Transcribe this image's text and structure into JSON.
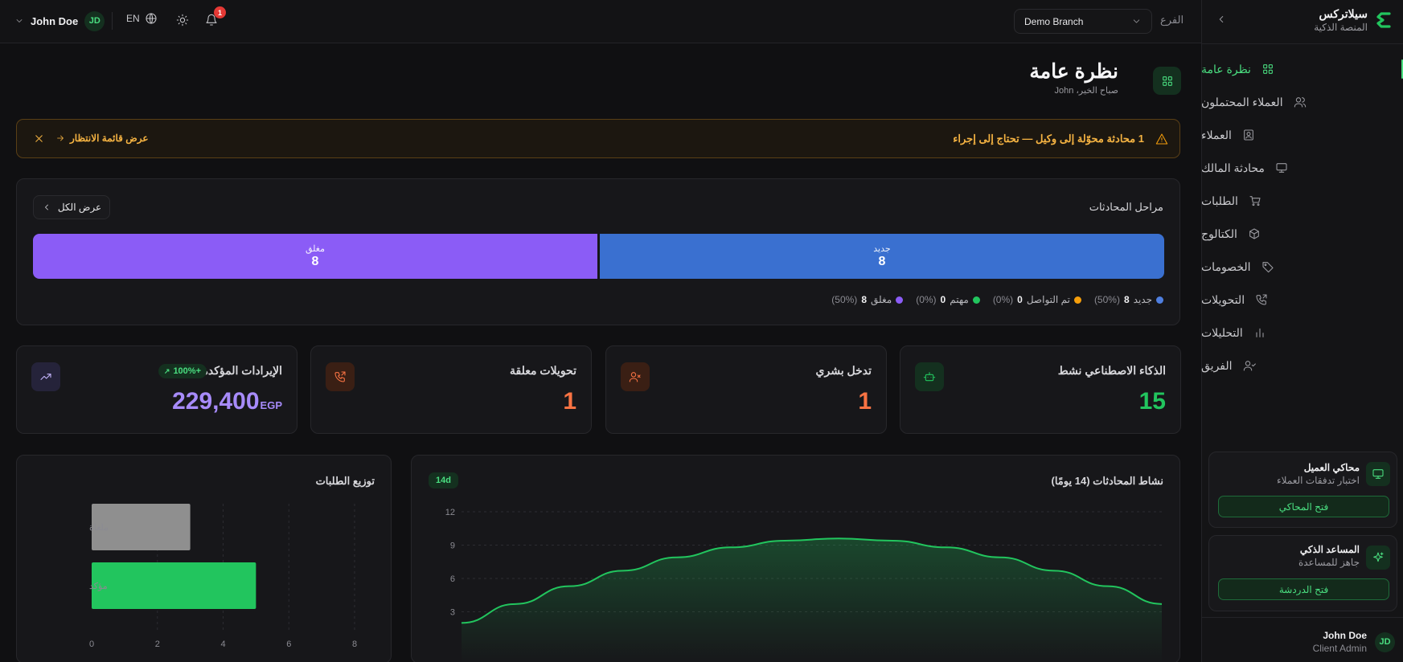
{
  "brand": {
    "name": "سيلاتركس",
    "tagline": "المنصة الذكية"
  },
  "header": {
    "branch_label": "الفرع",
    "branch_value": "Demo Branch",
    "notification_count": "1",
    "language": "EN",
    "user_name": "John Doe",
    "user_initials": "JD"
  },
  "sidebar": {
    "items": [
      {
        "label": "نظرة عامة",
        "icon": "dashboard-icon",
        "active": true
      },
      {
        "label": "العملاء المحتملون",
        "icon": "users-icon"
      },
      {
        "label": "العملاء",
        "icon": "contact-card-icon"
      },
      {
        "label": "محادثة المالك",
        "icon": "monitor-icon"
      },
      {
        "label": "الطلبات",
        "icon": "cart-icon"
      },
      {
        "label": "الكتالوج",
        "icon": "package-icon"
      },
      {
        "label": "الخصومات",
        "icon": "tag-icon"
      },
      {
        "label": "التحويلات",
        "icon": "phone-forward-icon"
      },
      {
        "label": "التحليلات",
        "icon": "bar-chart-icon"
      },
      {
        "label": "الفريق",
        "icon": "team-icon"
      }
    ],
    "simulator": {
      "title": "محاكي العميل",
      "subtitle": "اختبار تدفقات العملاء",
      "button": "فتح المحاكي"
    },
    "assistant": {
      "title": "المساعد الذكي",
      "subtitle": "جاهز للمساعدة",
      "button": "فتح الدردشة"
    },
    "footer_user": {
      "name": "John Doe",
      "role": "Client Admin",
      "initials": "JD"
    }
  },
  "page": {
    "title": "نظرة عامة",
    "greeting": "صباح الخير، John"
  },
  "alert": {
    "message": "1 محادثة محوّلة إلى وكيل — تحتاج إلى إجراء",
    "link": "عرض قائمة الانتظار"
  },
  "stages": {
    "title": "مراحل المحادثات",
    "view_all": "عرض الكل",
    "segments": [
      {
        "label": "جديد",
        "value": "8",
        "color": "#3a70d0",
        "fraction": 0.5
      },
      {
        "label": "مغلق",
        "value": "8",
        "color": "#8b5cf6",
        "fraction": 0.5
      }
    ],
    "legend": [
      {
        "label": "جديد",
        "count": "8",
        "pct": "(50%)",
        "color": "#4f7fe0"
      },
      {
        "label": "تم التواصل",
        "count": "0",
        "pct": "(0%)",
        "color": "#f59e0b"
      },
      {
        "label": "مهتم",
        "count": "0",
        "pct": "(0%)",
        "color": "#22c55e"
      },
      {
        "label": "مغلق",
        "count": "8",
        "pct": "(50%)",
        "color": "#8b5cf6"
      }
    ]
  },
  "stats": [
    {
      "title": "الذكاء الاصطناعي نشط",
      "value": "15",
      "color": "#22c55e",
      "icon": "bot-icon"
    },
    {
      "title": "تدخل بشري",
      "value": "1",
      "color": "#f97343",
      "icon": "user-x-icon"
    },
    {
      "title": "تحويلات معلقة",
      "value": "1",
      "color": "#f97343",
      "icon": "phone-forward-icon"
    },
    {
      "title": "الإيرادات المؤكدة",
      "value": "229,400",
      "unit": "EGP",
      "badge": "100%+",
      "color": "#a78bfa",
      "icon": "trending-up-icon"
    }
  ],
  "activity_chart": {
    "title": "نشاط المحادثات (14 يومًا)",
    "badge": "14d"
  },
  "orders_chart": {
    "title": "توزيع الطلبات"
  },
  "chart_data": [
    {
      "type": "area",
      "title": "نشاط المحادثات (14 يومًا)",
      "x": [
        1,
        2,
        3,
        4,
        5,
        6,
        7,
        8,
        9,
        10,
        11,
        12,
        13,
        14
      ],
      "series": [
        {
          "values": [
            2.0,
            3.7,
            5.3,
            6.7,
            7.9,
            8.8,
            9.4,
            9.6,
            9.4,
            8.8,
            7.9,
            6.7,
            5.3,
            3.7
          ]
        }
      ],
      "yticks": [
        "3",
        "6",
        "9",
        "12"
      ],
      "ylim": [
        0,
        12
      ],
      "grid": true,
      "color": "#22c55e"
    },
    {
      "type": "bar",
      "orientation": "horizontal",
      "title": "توزيع الطلبات",
      "categories": [
        "ملغاة",
        "مؤكد"
      ],
      "values": [
        3,
        5
      ],
      "colors": [
        "#8f8f8f",
        "#22c55e"
      ],
      "xticks": [
        "0",
        "2",
        "4",
        "6",
        "8"
      ],
      "xlim": [
        0,
        8
      ],
      "grid": true
    }
  ]
}
